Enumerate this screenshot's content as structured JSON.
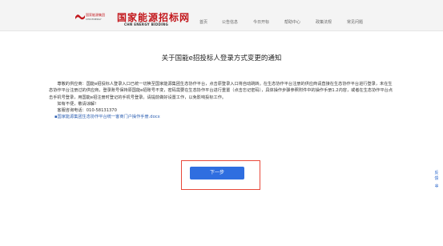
{
  "header": {
    "logo_cn": "国家能源集团",
    "logo_en": "CHN ENERGY",
    "brand_cn": "国家能源招标网",
    "brand_en": "CHN ENERGY BIDDING",
    "nav": [
      "首页",
      "公告信息",
      "今日开标",
      "帮助中心",
      "政策法规",
      "常见问题"
    ]
  },
  "notice": {
    "title": "关于国能e招投标人登录方式变更的通知",
    "greeting": "尊敬的供应商：国能e招投标人登录入口已统一切换至国家能源集团生态协作平台，点击原登录入口将自动跳转。在生态协作平台注册的供应商请直接在生态协作平台进行登录，未在生态协作平台注册过的供应商，登录账号保持原国能e招账号不变，密码需要在生态协作平台进行重置（点击忘记密码），具体操作步骤参照附件中的操作手册1.2内容，或者在生态协作平台点击手机号登录，用国能e招注册时登记的手机号登录。请提前做好设置工作，以免影响投标工作。",
    "thanks": "如有不便，敬请谅解!",
    "hotline_label": "客服咨询电话：",
    "hotline_number": "010-58131370",
    "attachment": "国家能源集团生态协作平台统一客商门户操作手册.docx"
  },
  "next_button": "下一步",
  "side_tool": "反馈"
}
